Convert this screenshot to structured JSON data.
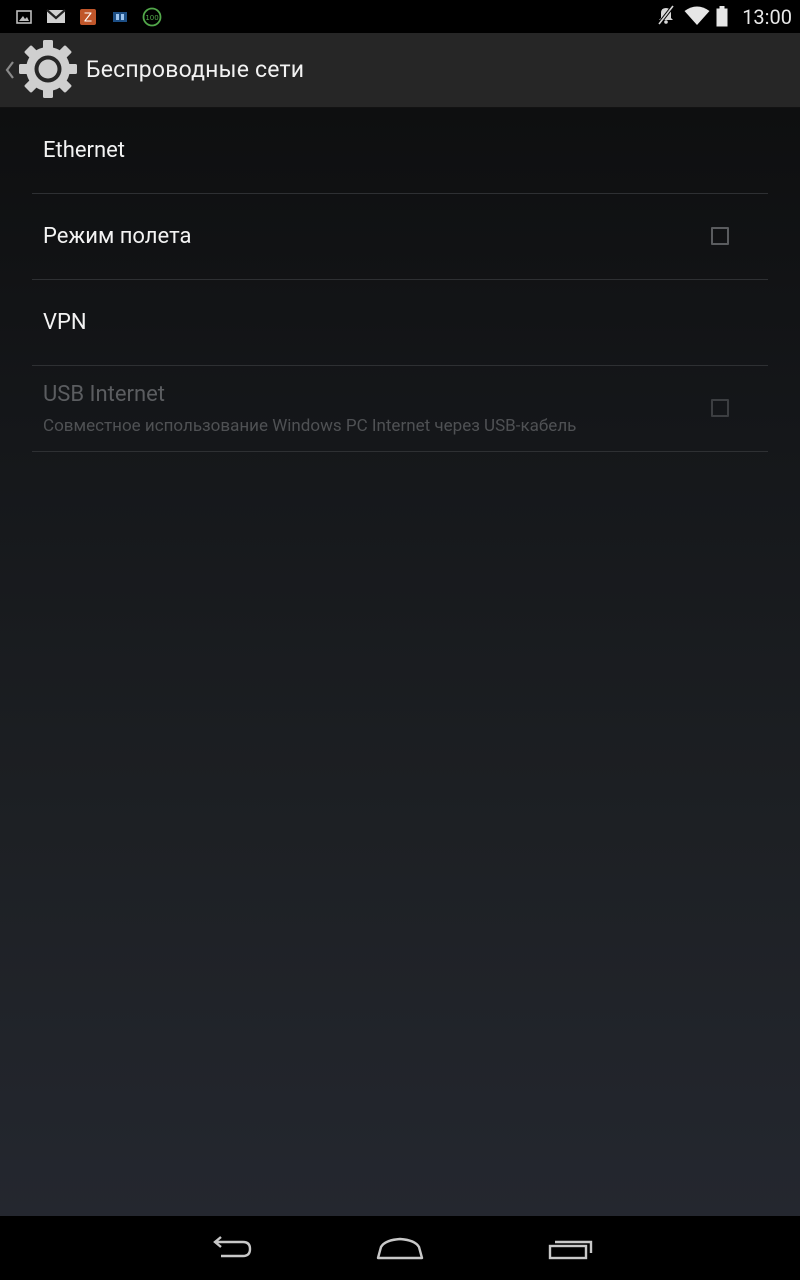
{
  "status_bar": {
    "notification_icons": [
      "image-icon",
      "gmail-icon",
      "zoo-app-icon",
      "reader-app-icon",
      "battery-100-icon"
    ],
    "system_icons": [
      "mute-icon",
      "wifi-icon",
      "battery-icon"
    ],
    "time": "13:00",
    "badge_100": "100",
    "zoo_letter": "Z"
  },
  "action_bar": {
    "title": "Беспроводные сети",
    "icon": "settings-gear-icon"
  },
  "preferences": [
    {
      "title": "Ethernet",
      "has_checkbox": false,
      "enabled": true
    },
    {
      "title": "Режим полета",
      "has_checkbox": true,
      "checked": false,
      "enabled": true
    },
    {
      "title": "VPN",
      "has_checkbox": false,
      "enabled": true
    },
    {
      "title": "USB Internet",
      "summary": "Совместное использование Windows PC Internet через USB-кабель",
      "has_checkbox": true,
      "checked": false,
      "enabled": false
    }
  ],
  "nav_bar": {
    "buttons": [
      "back-icon",
      "home-icon",
      "recent-apps-icon"
    ]
  },
  "colors": {
    "status_bar_bg": "#000000",
    "action_bar_bg": "#262626",
    "text_primary": "#f3f3f3",
    "text_disabled": "#5b5d60",
    "divider": "#2e3033"
  }
}
